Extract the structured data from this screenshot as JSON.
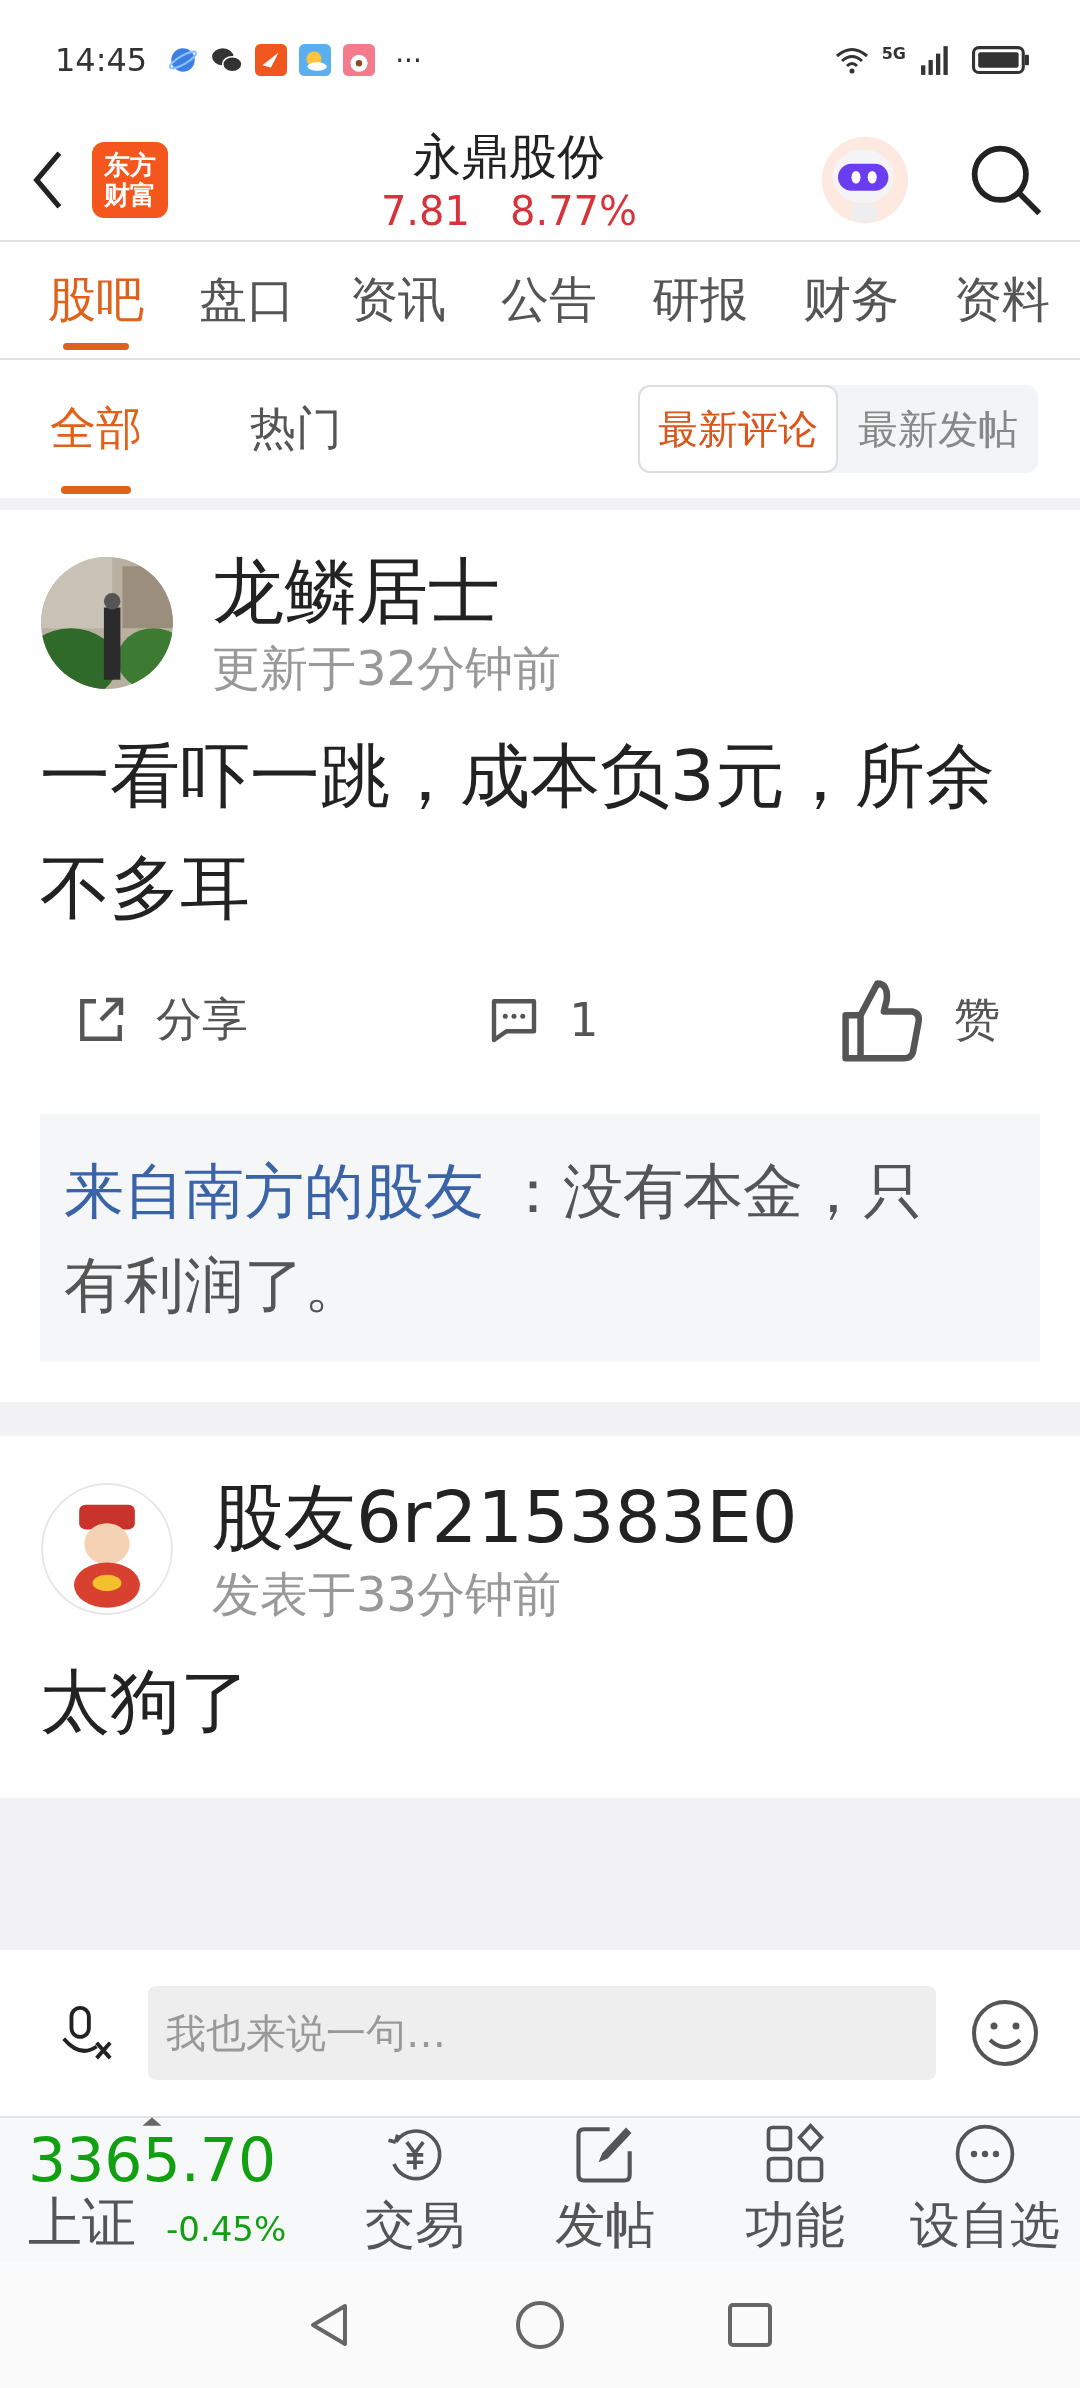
{
  "status_bar": {
    "time": "14:45",
    "more": "···",
    "network": "5G"
  },
  "header": {
    "title": "永鼎股份",
    "price": "7.81",
    "change": "8.77%",
    "logo_lines": [
      "东方",
      "财富"
    ]
  },
  "tabs": [
    {
      "label": "股吧",
      "selected": true
    },
    {
      "label": "盘口",
      "selected": false
    },
    {
      "label": "资讯",
      "selected": false
    },
    {
      "label": "公告",
      "selected": false
    },
    {
      "label": "研报",
      "selected": false
    },
    {
      "label": "财务",
      "selected": false
    },
    {
      "label": "资料",
      "selected": false
    }
  ],
  "subtabs": [
    {
      "label": "全部",
      "selected": true
    },
    {
      "label": "热门",
      "selected": false
    }
  ],
  "sort_toggle": [
    {
      "label": "最新评论",
      "selected": true
    },
    {
      "label": "最新发帖",
      "selected": false
    }
  ],
  "posts": [
    {
      "author": "龙鳞居士",
      "time": "更新于32分钟前",
      "text": "一看吓一跳，成本负3元，所余不多耳",
      "share": "分享",
      "comments": "1",
      "like": "赞",
      "replies": [
        {
          "author": "来自南方的股友",
          "text": "：没有本金，只有利润了。"
        }
      ]
    },
    {
      "author": "股友6r215383E0",
      "time": "发表于33分钟前",
      "text": "太狗了"
    }
  ],
  "comment_bar": {
    "placeholder": "我也来说一句…"
  },
  "index": {
    "value": "3365.70",
    "name": "上证",
    "change": "-0.45%"
  },
  "bottom_nav": [
    {
      "label": "交易",
      "kind": "trade"
    },
    {
      "label": "发帖",
      "kind": "post"
    },
    {
      "label": "功能",
      "kind": "apps"
    },
    {
      "label": "设自选",
      "kind": "more"
    }
  ]
}
